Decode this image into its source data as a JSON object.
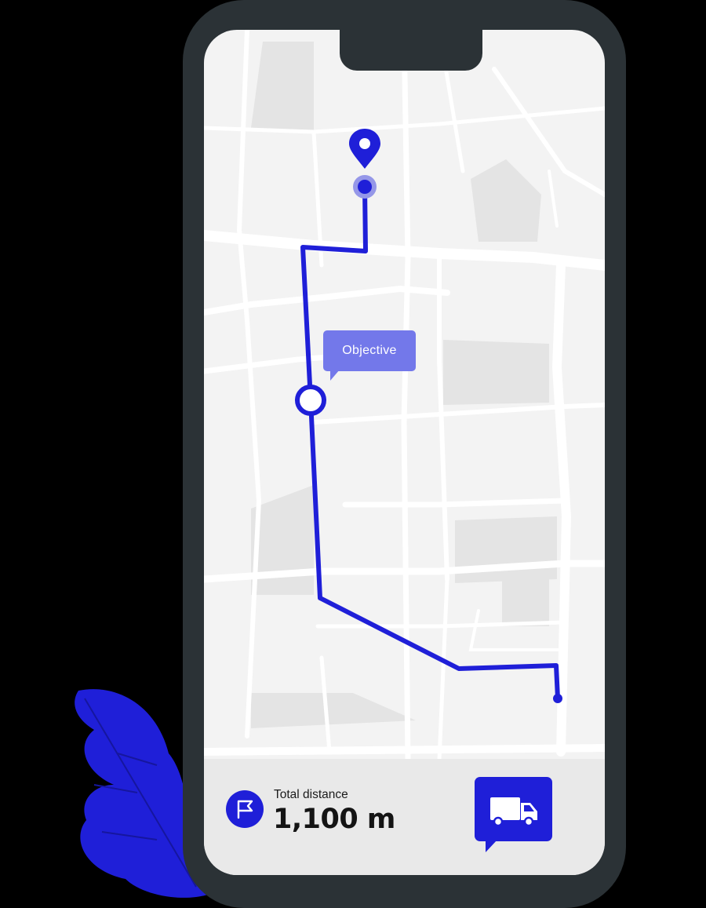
{
  "map": {
    "tooltip_label": "Objective"
  },
  "summary": {
    "distance_label": "Total distance",
    "distance_value": "1,100 m"
  },
  "icons": {
    "destination": "map-pin-icon",
    "flag": "flag-icon",
    "truck": "truck-icon",
    "leaf": "leaf-decoration"
  },
  "colors": {
    "route": "#1f1fd8",
    "tooltip": "#7378ea",
    "phone_frame": "#2b3236",
    "map_background": "#f3f3f3",
    "map_block": "#e4e4e4",
    "panel": "#e9e9e9"
  }
}
